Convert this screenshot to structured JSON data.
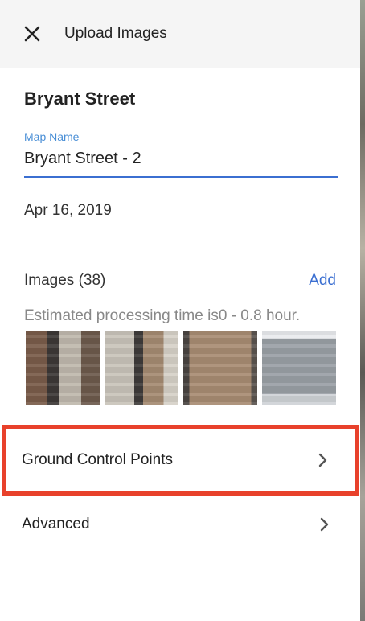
{
  "header": {
    "title": "Upload Images",
    "close_icon": "close-icon"
  },
  "map": {
    "title": "Bryant Street",
    "name_label": "Map Name",
    "name_value": "Bryant Street - 2",
    "date": "Apr 16, 2019"
  },
  "images": {
    "label": "Images (38)",
    "add_label": "Add",
    "estimate": "Estimated processing time is0 - 0.8 hour.",
    "thumbnails": [
      "aerial-thumbnail-1",
      "aerial-thumbnail-2",
      "aerial-thumbnail-3",
      "aerial-thumbnail-4"
    ]
  },
  "nav": {
    "gcp_label": "Ground Control Points",
    "advanced_label": "Advanced"
  },
  "colors": {
    "accent": "#3b6fd1",
    "highlight": "#e8412b"
  }
}
